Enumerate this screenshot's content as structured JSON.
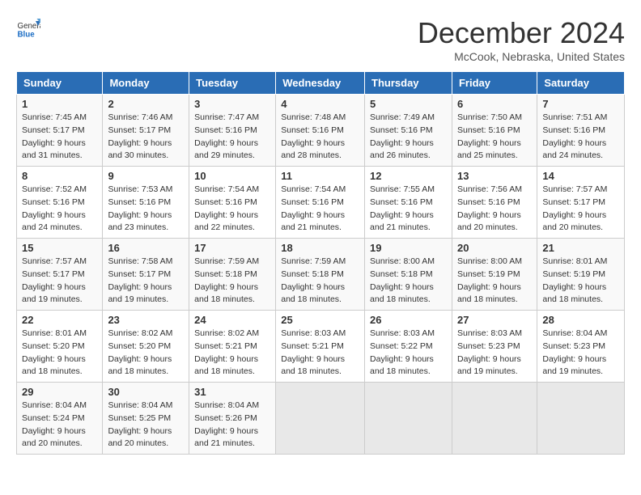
{
  "header": {
    "logo_general": "General",
    "logo_blue": "Blue",
    "title": "December 2024",
    "location": "McCook, Nebraska, United States"
  },
  "days_of_week": [
    "Sunday",
    "Monday",
    "Tuesday",
    "Wednesday",
    "Thursday",
    "Friday",
    "Saturday"
  ],
  "weeks": [
    [
      {
        "day": 1,
        "sun": "7:45 AM",
        "set": "5:17 PM",
        "dh": "9 hours and 31 minutes."
      },
      {
        "day": 2,
        "sun": "7:46 AM",
        "set": "5:17 PM",
        "dh": "9 hours and 30 minutes."
      },
      {
        "day": 3,
        "sun": "7:47 AM",
        "set": "5:16 PM",
        "dh": "9 hours and 29 minutes."
      },
      {
        "day": 4,
        "sun": "7:48 AM",
        "set": "5:16 PM",
        "dh": "9 hours and 28 minutes."
      },
      {
        "day": 5,
        "sun": "7:49 AM",
        "set": "5:16 PM",
        "dh": "9 hours and 26 minutes."
      },
      {
        "day": 6,
        "sun": "7:50 AM",
        "set": "5:16 PM",
        "dh": "9 hours and 25 minutes."
      },
      {
        "day": 7,
        "sun": "7:51 AM",
        "set": "5:16 PM",
        "dh": "9 hours and 24 minutes."
      }
    ],
    [
      {
        "day": 8,
        "sun": "7:52 AM",
        "set": "5:16 PM",
        "dh": "9 hours and 24 minutes."
      },
      {
        "day": 9,
        "sun": "7:53 AM",
        "set": "5:16 PM",
        "dh": "9 hours and 23 minutes."
      },
      {
        "day": 10,
        "sun": "7:54 AM",
        "set": "5:16 PM",
        "dh": "9 hours and 22 minutes."
      },
      {
        "day": 11,
        "sun": "7:54 AM",
        "set": "5:16 PM",
        "dh": "9 hours and 21 minutes."
      },
      {
        "day": 12,
        "sun": "7:55 AM",
        "set": "5:16 PM",
        "dh": "9 hours and 21 minutes."
      },
      {
        "day": 13,
        "sun": "7:56 AM",
        "set": "5:16 PM",
        "dh": "9 hours and 20 minutes."
      },
      {
        "day": 14,
        "sun": "7:57 AM",
        "set": "5:17 PM",
        "dh": "9 hours and 20 minutes."
      }
    ],
    [
      {
        "day": 15,
        "sun": "7:57 AM",
        "set": "5:17 PM",
        "dh": "9 hours and 19 minutes."
      },
      {
        "day": 16,
        "sun": "7:58 AM",
        "set": "5:17 PM",
        "dh": "9 hours and 19 minutes."
      },
      {
        "day": 17,
        "sun": "7:59 AM",
        "set": "5:18 PM",
        "dh": "9 hours and 18 minutes."
      },
      {
        "day": 18,
        "sun": "7:59 AM",
        "set": "5:18 PM",
        "dh": "9 hours and 18 minutes."
      },
      {
        "day": 19,
        "sun": "8:00 AM",
        "set": "5:18 PM",
        "dh": "9 hours and 18 minutes."
      },
      {
        "day": 20,
        "sun": "8:00 AM",
        "set": "5:19 PM",
        "dh": "9 hours and 18 minutes."
      },
      {
        "day": 21,
        "sun": "8:01 AM",
        "set": "5:19 PM",
        "dh": "9 hours and 18 minutes."
      }
    ],
    [
      {
        "day": 22,
        "sun": "8:01 AM",
        "set": "5:20 PM",
        "dh": "9 hours and 18 minutes."
      },
      {
        "day": 23,
        "sun": "8:02 AM",
        "set": "5:20 PM",
        "dh": "9 hours and 18 minutes."
      },
      {
        "day": 24,
        "sun": "8:02 AM",
        "set": "5:21 PM",
        "dh": "9 hours and 18 minutes."
      },
      {
        "day": 25,
        "sun": "8:03 AM",
        "set": "5:21 PM",
        "dh": "9 hours and 18 minutes."
      },
      {
        "day": 26,
        "sun": "8:03 AM",
        "set": "5:22 PM",
        "dh": "9 hours and 18 minutes."
      },
      {
        "day": 27,
        "sun": "8:03 AM",
        "set": "5:23 PM",
        "dh": "9 hours and 19 minutes."
      },
      {
        "day": 28,
        "sun": "8:04 AM",
        "set": "5:23 PM",
        "dh": "9 hours and 19 minutes."
      }
    ],
    [
      {
        "day": 29,
        "sun": "8:04 AM",
        "set": "5:24 PM",
        "dh": "9 hours and 20 minutes."
      },
      {
        "day": 30,
        "sun": "8:04 AM",
        "set": "5:25 PM",
        "dh": "9 hours and 20 minutes."
      },
      {
        "day": 31,
        "sun": "8:04 AM",
        "set": "5:26 PM",
        "dh": "9 hours and 21 minutes."
      },
      null,
      null,
      null,
      null
    ]
  ],
  "labels": {
    "sunrise": "Sunrise:",
    "sunset": "Sunset:",
    "daylight": "Daylight:"
  }
}
